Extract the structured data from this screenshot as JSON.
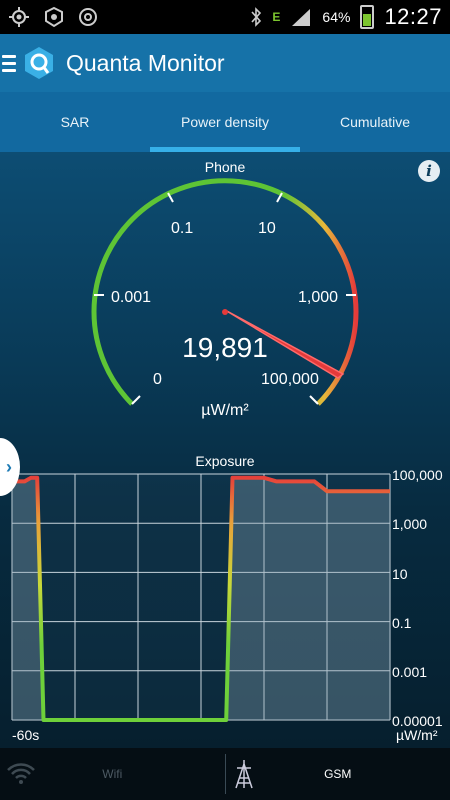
{
  "status_bar": {
    "battery": "64%",
    "time": "12:27",
    "data_indicator": "E"
  },
  "app": {
    "title": "Quanta Monitor"
  },
  "tabs": [
    {
      "label": "SAR",
      "active": false
    },
    {
      "label": "Power density",
      "active": true
    },
    {
      "label": "Cumulative",
      "active": false
    }
  ],
  "gauge": {
    "title": "Phone",
    "info_icon": "i",
    "tick_labels": [
      "0",
      "0.001",
      "0.1",
      "10",
      "1,000",
      "100,000"
    ],
    "value": "19,891",
    "unit": "µW/m²",
    "colors": {
      "low": "#5ec435",
      "mid": "#e8c23a",
      "high": "#e53a3a"
    }
  },
  "exposure_chart": {
    "title": "Exposure",
    "y_tick_labels": [
      "100,000",
      "1,000",
      "10",
      "0.1",
      "0.001",
      "0.00001"
    ],
    "x_label_start": "-60s",
    "y_unit": "µW/m²"
  },
  "chart_data": {
    "type": "line",
    "title": "Exposure",
    "xlabel": "",
    "ylabel": "µW/m²",
    "y_scale": "log",
    "ylim": [
      1e-05,
      100000
    ],
    "xlim": [
      -60,
      0
    ],
    "series": [
      {
        "x": [
          -60,
          -58,
          -57,
          -56,
          -55,
          -26,
          -25,
          -23,
          -20,
          -18,
          -12,
          -10,
          0
        ],
        "y": [
          50000,
          50000,
          70000,
          70000,
          1e-05,
          1e-05,
          70000,
          70000,
          70000,
          50000,
          50000,
          20000,
          20000
        ]
      }
    ],
    "grid": true
  },
  "bottom_bar": {
    "items": [
      {
        "label": "Wifi",
        "active": false
      },
      {
        "label": "GSM",
        "active": true
      }
    ]
  }
}
